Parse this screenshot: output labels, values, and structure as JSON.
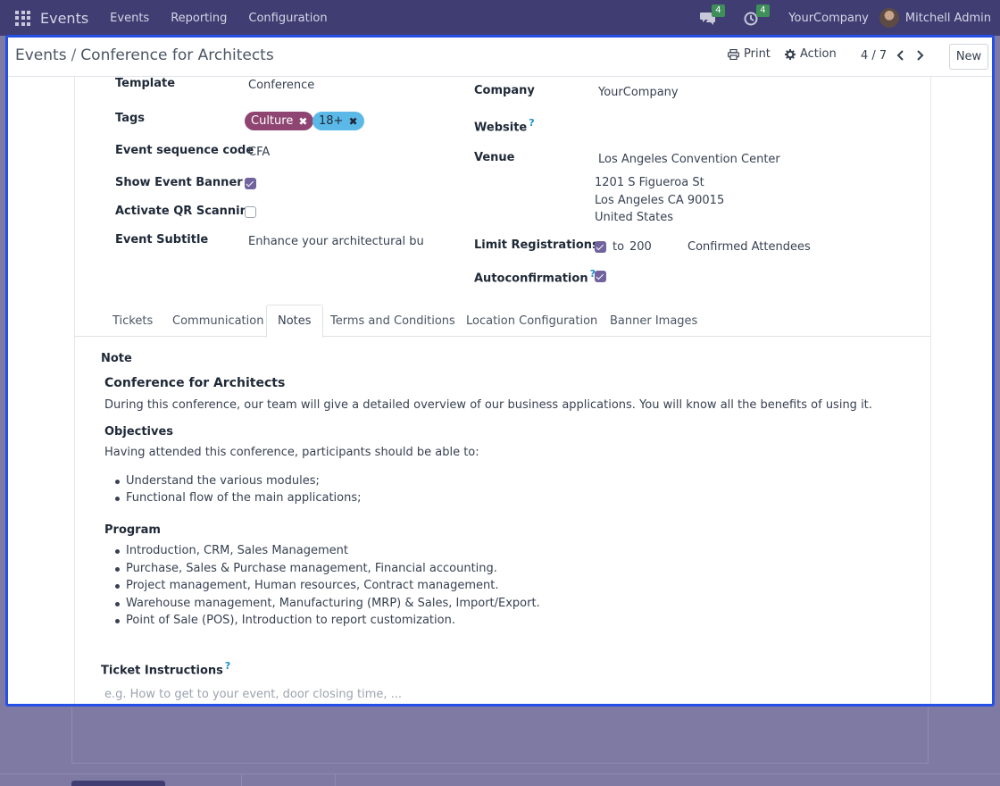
{
  "navbar": {
    "app_name": "Events",
    "menu": [
      "Events",
      "Reporting",
      "Configuration"
    ],
    "messages_count": "4",
    "activities_count": "4",
    "company": "YourCompany",
    "user": "Mitchell Admin"
  },
  "control_panel": {
    "breadcrumb_parent": "Events",
    "breadcrumb_separator": "/",
    "breadcrumb_current": "Conference for Architects",
    "print_label": "Print",
    "action_label": "Action",
    "pager": "4 / 7",
    "new_label": "New"
  },
  "form": {
    "left": {
      "template_label": "Template",
      "template_value": "Conference",
      "tags_label": "Tags",
      "tags": [
        {
          "label": "Culture",
          "color": "#8f4572"
        },
        {
          "label": "18+",
          "color": "#5bb9e8"
        }
      ],
      "sequence_label": "Event sequence code",
      "sequence_value": "CFA",
      "banner_label": "Show Event Banner",
      "banner_checked": true,
      "qr_label": "Activate QR Scanning",
      "qr_checked": false,
      "subtitle_label": "Event Subtitle",
      "subtitle_value": "Enhance your architectural busine"
    },
    "right": {
      "company_label": "Company",
      "company_value": "YourCompany",
      "website_label": "Website",
      "venue_label": "Venue",
      "venue_name": "Los Angeles Convention Center",
      "venue_street": "1201 S Figueroa St",
      "venue_city": "Los Angeles CA 90015",
      "venue_country": "United States",
      "limit_label": "Limit Registrations",
      "limit_checked": true,
      "limit_to": "to",
      "limit_value": "200",
      "limit_unit": "Confirmed Attendees",
      "autoconfirm_label": "Autoconfirmation",
      "autoconfirm_checked": true
    },
    "help_mark": "?"
  },
  "tabs": [
    "Tickets",
    "Communication",
    "Notes",
    "Terms and Conditions",
    "Location Configuration",
    "Banner Images"
  ],
  "active_tab": "Notes",
  "notes": {
    "note_label": "Note",
    "title": "Conference for Architects",
    "intro": "During this conference, our team will give a detailed overview of our business applications. You will know all the benefits of using it.",
    "objectives_heading": "Objectives",
    "objectives_intro": "Having attended this conference, participants should be able to:",
    "objectives": [
      "Understand the various modules;",
      "Functional flow of the main applications;"
    ],
    "program_heading": "Program",
    "program": [
      "Introduction, CRM, Sales Management",
      "Purchase, Sales & Purchase management, Financial accounting.",
      "Project management, Human resources, Contract management.",
      "Warehouse management, Manufacturing (MRP) & Sales, Import/Export.",
      "Point of Sale (POS), Introduction to report customization."
    ],
    "ticket_instructions_label": "Ticket Instructions",
    "ticket_instructions_placeholder": "e.g. How to get to your event, door closing time, ..."
  },
  "colors": {
    "navbar": "#3f3d72",
    "backdrop": "#7e7aa3",
    "dialog_border": "#2550e6",
    "checkbox": "#71639e",
    "help": "#1d8ec3"
  }
}
